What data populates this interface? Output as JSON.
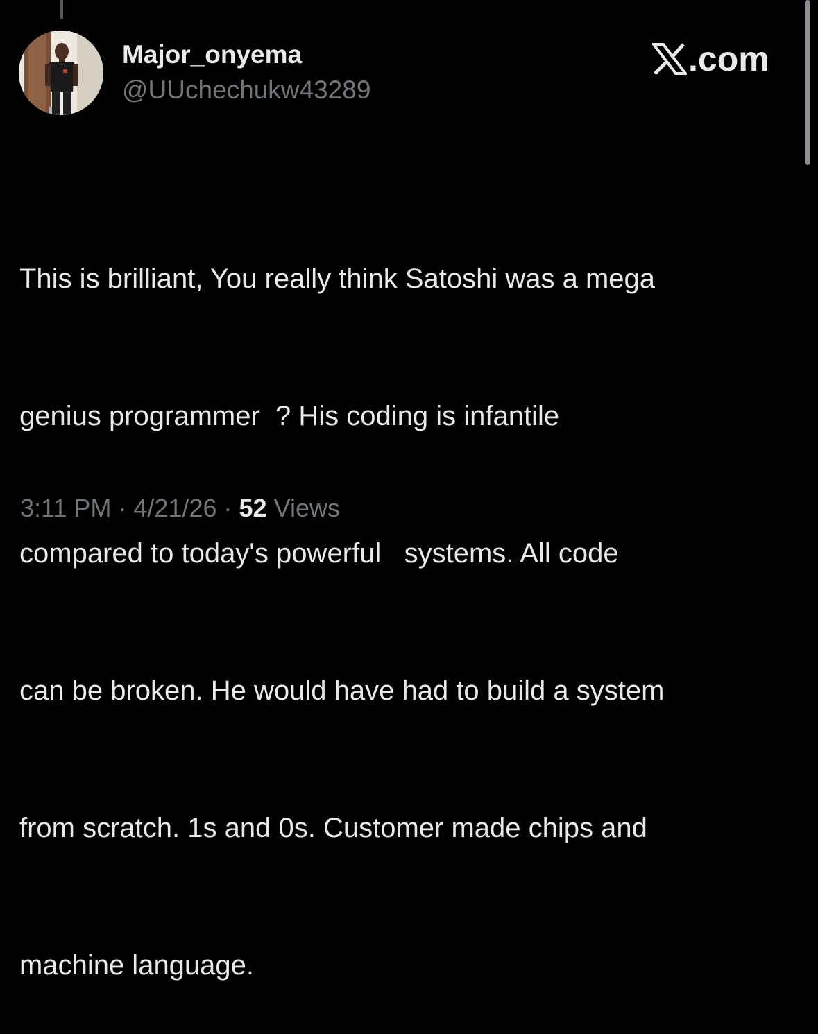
{
  "tweet": {
    "author": {
      "display_name": "Major_onyema",
      "handle": "@UUchechukw43289"
    },
    "brand": {
      "icon": "x-logo-icon",
      "text": ".com"
    },
    "text_lines": [
      "This is brilliant, You really think Satoshi was a mega",
      "genius programmer  ? His coding is infantile",
      "compared to today's powerful   systems. All code",
      "can be broken. He would have had to build a system",
      "from scratch. 1s and 0s. Customer made chips and",
      "machine language."
    ],
    "meta": {
      "time": "3:11 PM",
      "separator": " · ",
      "date": "4/21/26",
      "views_count": "52",
      "views_label": " Views"
    }
  },
  "colors": {
    "background": "#000000",
    "primary_text": "#e7e9ea",
    "secondary_text": "#71767b",
    "thread_line": "#555a5e",
    "scrollbar": "#8b8f93"
  }
}
